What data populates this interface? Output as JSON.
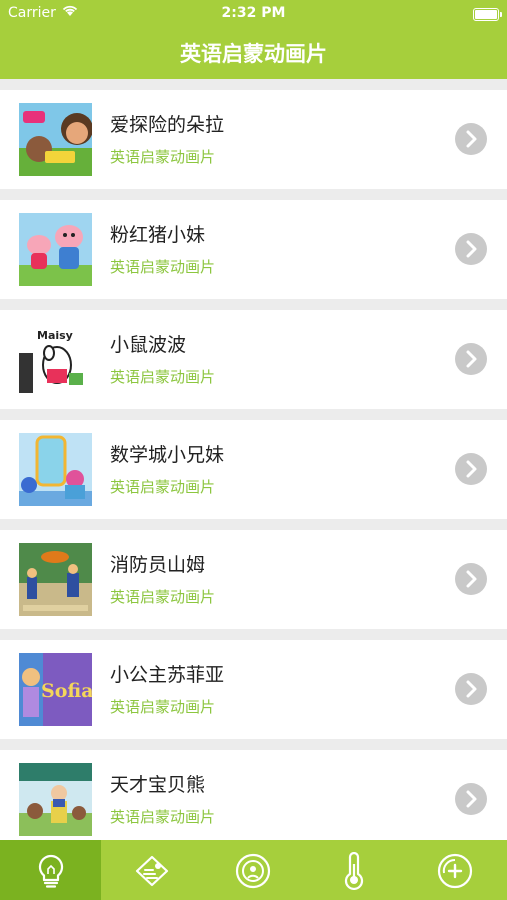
{
  "status_bar": {
    "carrier": "Carrier",
    "time": "2:32 PM"
  },
  "header": {
    "title": "英语启蒙动画片"
  },
  "list": [
    {
      "title": "爱探险的朵拉",
      "subtitle": "英语启蒙动画片",
      "thumbnail": "dora-thumbnail"
    },
    {
      "title": "粉红猪小妹",
      "subtitle": "英语启蒙动画片",
      "thumbnail": "peppa-pig-thumbnail"
    },
    {
      "title": "小鼠波波",
      "subtitle": "英语启蒙动画片",
      "thumbnail": "maisy-thumbnail",
      "thumb_text": "Maisy"
    },
    {
      "title": "数学城小兄妹",
      "subtitle": "英语启蒙动画片",
      "thumbnail": "team-umizoomi-thumbnail"
    },
    {
      "title": "消防员山姆",
      "subtitle": "英语启蒙动画片",
      "thumbnail": "fireman-sam-thumbnail"
    },
    {
      "title": "小公主苏菲亚",
      "subtitle": "英语启蒙动画片",
      "thumbnail": "sofia-the-first-thumbnail",
      "thumb_text": "Sofia"
    },
    {
      "title": "天才宝贝熊",
      "subtitle": "英语启蒙动画片",
      "thumbnail": "baby-bear-thumbnail"
    }
  ],
  "tab_bar": {
    "tabs": [
      {
        "icon": "lightbulb-icon",
        "active": true
      },
      {
        "icon": "notes-icon",
        "active": false
      },
      {
        "icon": "target-icon",
        "active": false
      },
      {
        "icon": "thermometer-icon",
        "active": false
      },
      {
        "icon": "add-circle-icon",
        "active": false
      }
    ]
  },
  "colors": {
    "brand_green": "#a6cf3c",
    "active_tab": "#7bb220",
    "subtitle_green": "#8cc63f",
    "chevron_gray": "#c9c9c9"
  }
}
